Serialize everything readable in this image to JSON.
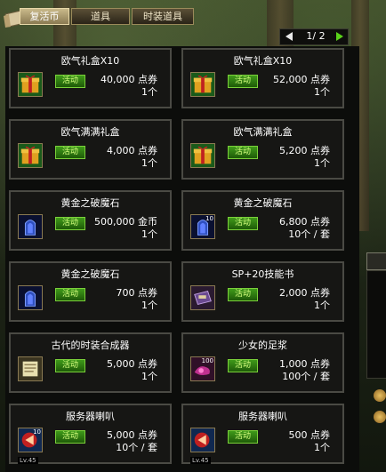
{
  "tabs": [
    {
      "label": "复活币",
      "active": true
    },
    {
      "label": "道具",
      "active": false
    },
    {
      "label": "时装道具",
      "active": false
    }
  ],
  "pager": {
    "text": "1/ 2"
  },
  "badge_label": "活动",
  "items": [
    {
      "title": "欧气礼盒X10",
      "price": "40,000 点券",
      "qty": "1个",
      "icon": "gift-box-icon"
    },
    {
      "title": "欧气礼盒X10",
      "price": "52,000 点券",
      "qty": "1个",
      "icon": "gift-box-icon"
    },
    {
      "title": "欧气满满礼盒",
      "price": "4,000 点券",
      "qty": "1个",
      "icon": "gift-box-icon"
    },
    {
      "title": "欧气满满礼盒",
      "price": "5,200 点券",
      "qty": "1个",
      "icon": "gift-box-icon"
    },
    {
      "title": "黄金之破魔石",
      "price": "500,000 金币",
      "qty": "1个",
      "icon": "magic-stone-icon"
    },
    {
      "title": "黄金之破魔石",
      "price": "6,800 点券",
      "qty": "10个 / 套",
      "icon": "magic-stone-icon",
      "icon_count": "10"
    },
    {
      "title": "黄金之破魔石",
      "price": "700 点券",
      "qty": "1个",
      "icon": "magic-stone-icon"
    },
    {
      "title": "SP+20技能书",
      "price": "2,000 点券",
      "qty": "1个",
      "icon": "skill-book-icon"
    },
    {
      "title": "古代的时装合成器",
      "price": "5,000 点券",
      "qty": "1个",
      "icon": "scroll-icon"
    },
    {
      "title": "少女的足浆",
      "price": "1,000 点券",
      "qty": "100个 / 套",
      "icon": "potion-icon",
      "icon_count": "100"
    },
    {
      "title": "服务器喇叭",
      "price": "5,000 点券",
      "qty": "10个 / 套",
      "icon": "megaphone-icon",
      "icon_count": "10",
      "level": "Lv.45"
    },
    {
      "title": "服务器喇叭",
      "price": "500 点券",
      "qty": "1个",
      "icon": "megaphone-icon",
      "level": "Lv.45"
    }
  ],
  "colors": {
    "badge_green": "#3f9a1a",
    "page_next": "#5ad21a",
    "card_border": "#4a4a44"
  }
}
